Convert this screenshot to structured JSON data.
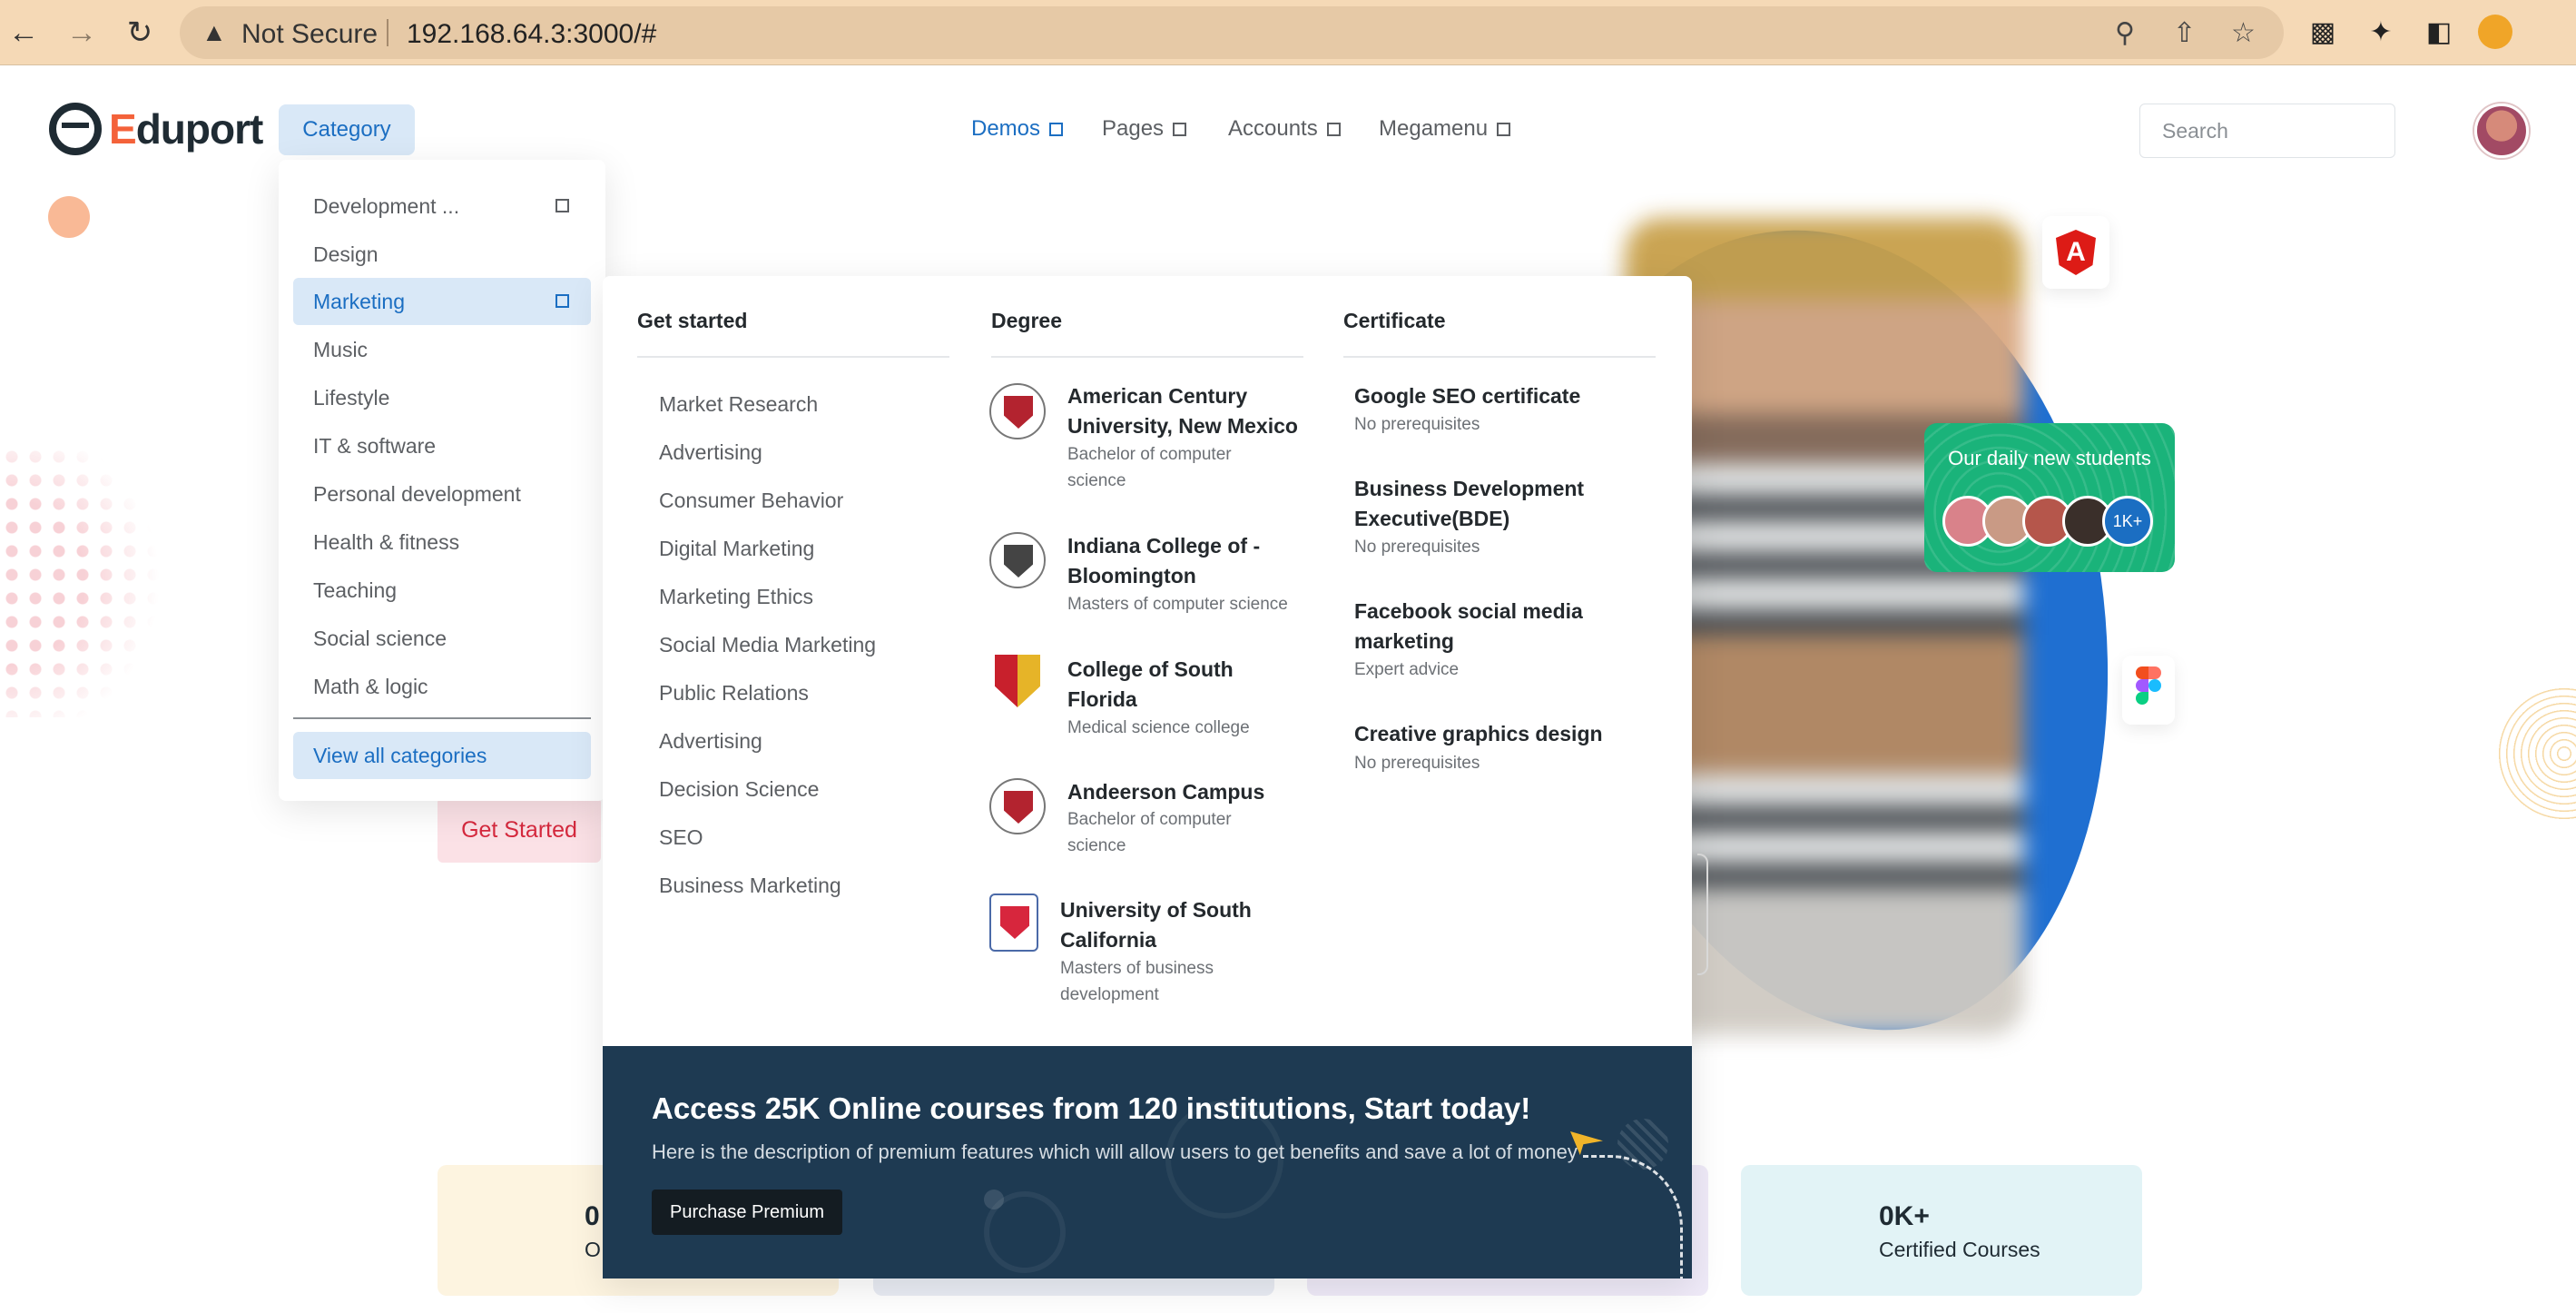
{
  "browser": {
    "security_label": "Not Secure",
    "url": "192.168.64.3:3000/#"
  },
  "header": {
    "logo_first": "E",
    "logo_rest": "duport",
    "category_button": "Category",
    "nav": [
      {
        "label": "Demos",
        "active": true
      },
      {
        "label": "Pages",
        "active": false
      },
      {
        "label": "Accounts",
        "active": false
      },
      {
        "label": "Megamenu",
        "active": false
      }
    ],
    "search_placeholder": "Search"
  },
  "category_menu": {
    "items": [
      {
        "label": "Development ...",
        "has_submenu": true
      },
      {
        "label": "Design",
        "has_submenu": false
      },
      {
        "label": "Marketing",
        "has_submenu": true,
        "active": true
      },
      {
        "label": "Music",
        "has_submenu": false
      },
      {
        "label": "Lifestyle",
        "has_submenu": false
      },
      {
        "label": "IT & software",
        "has_submenu": false
      },
      {
        "label": "Personal development",
        "has_submenu": false
      },
      {
        "label": "Health & fitness",
        "has_submenu": false
      },
      {
        "label": "Teaching",
        "has_submenu": false
      },
      {
        "label": "Social science",
        "has_submenu": false
      },
      {
        "label": "Math & logic",
        "has_submenu": false
      }
    ],
    "view_all": "View all categories"
  },
  "mega_menu": {
    "get_started": {
      "title": "Get started",
      "items": [
        "Market Research",
        "Advertising",
        "Consumer Behavior",
        "Digital Marketing",
        "Marketing Ethics",
        "Social Media Marketing",
        "Public Relations",
        "Advertising",
        "Decision Science",
        "SEO",
        "Business Marketing"
      ]
    },
    "degree": {
      "title": "Degree",
      "items": [
        {
          "name_lines": [
            "American Century",
            "University, New Mexico"
          ],
          "sub_lines": [
            "Bachelor of computer",
            "science"
          ]
        },
        {
          "name_lines": [
            "Indiana College of -",
            "Bloomington"
          ],
          "sub_lines": [
            "Masters of computer science"
          ]
        },
        {
          "name_lines": [
            "College of South",
            "Florida"
          ],
          "sub_lines": [
            "Medical science college"
          ]
        },
        {
          "name_lines": [
            "Andeerson Campus"
          ],
          "sub_lines": [
            "Bachelor of computer",
            "science"
          ]
        },
        {
          "name_lines": [
            "University of South",
            "California"
          ],
          "sub_lines": [
            "Masters of business",
            "development"
          ]
        }
      ]
    },
    "certificate": {
      "title": "Certificate",
      "items": [
        {
          "name_lines": [
            "Google SEO certificate"
          ],
          "sub": "No prerequisites"
        },
        {
          "name_lines": [
            "Business Development",
            "Executive(BDE)"
          ],
          "sub": "No prerequisites"
        },
        {
          "name_lines": [
            "Facebook social media",
            "marketing"
          ],
          "sub": "Expert advice"
        },
        {
          "name_lines": [
            "Creative graphics design"
          ],
          "sub": "No prerequisites"
        }
      ]
    },
    "promo": {
      "title": "Access 25K Online courses from 120 institutions, Start today!",
      "description": "Here is the description of premium features which will allow users to get benefits and save a lot of money",
      "button": "Purchase Premium"
    }
  },
  "hero": {
    "students_title": "Our daily new students",
    "students_count": "1K+",
    "get_started": "Get Started"
  },
  "stats": [
    {
      "value": "0",
      "label": "O"
    },
    {
      "value": "0K+",
      "label": "Certified Courses"
    }
  ],
  "colors": {
    "accent": "#1b6ec2",
    "brand_orange": "#f4623a",
    "promo_bg": "#1e3a52",
    "students_card": "#1ab37a"
  }
}
